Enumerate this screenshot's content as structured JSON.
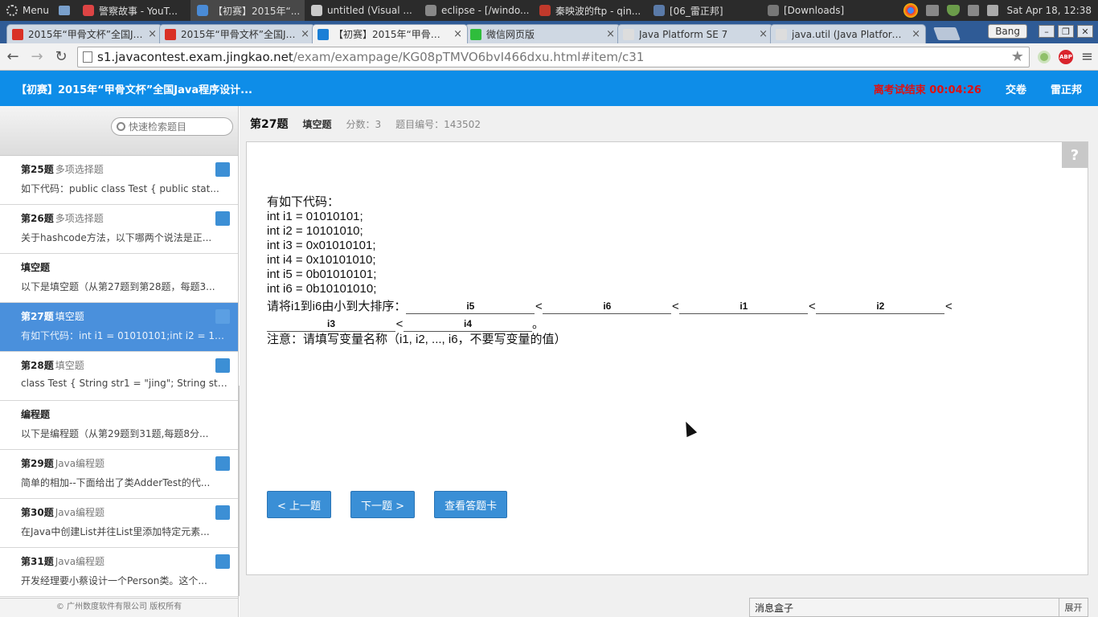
{
  "taskbar": {
    "menu_label": "Menu",
    "apps": [
      {
        "label": "警察故事 - YouT...",
        "color": "#d44"
      },
      {
        "label": "【初赛】2015年“...",
        "color": "#4a8bd6"
      },
      {
        "label": "untitled (Visual ...",
        "color": "#c9c9c9"
      },
      {
        "label": "eclipse - [/windo...",
        "color": "#888"
      },
      {
        "label": "秦映波的ftp - qin...",
        "color": "#c0392b"
      },
      {
        "label": "[06_雷正邦]",
        "color": "#5a7aa8"
      },
      {
        "label": "[Downloads]",
        "color": "#777"
      }
    ],
    "clock": "Sat Apr 18, 12:38"
  },
  "browser": {
    "tabs": [
      {
        "title": "2015年“甲骨文杯”全国Jav",
        "favicon_color": "#d93025",
        "active": false
      },
      {
        "title": "2015年“甲骨文杯”全国Jav",
        "favicon_color": "#d93025",
        "active": false
      },
      {
        "title": "【初赛】2015年“甲骨文杯",
        "favicon_color": "#1a7fd6",
        "active": true
      },
      {
        "title": "微信网页版",
        "favicon_color": "#2fbd3c",
        "active": false
      },
      {
        "title": "Java Platform SE 7",
        "favicon_color": "#dddddd",
        "active": false
      },
      {
        "title": "java.util (Java Platform SE",
        "favicon_color": "#dddddd",
        "active": false
      }
    ],
    "profile_label": "Bang",
    "url_host": "s1.javacontest.exam.jingkao.net",
    "url_path": "/exam/exampage/KG08pTMVO6bvI466dxu.html#item/c31",
    "abp_label": "ABP"
  },
  "app": {
    "title": "【初赛】2015年“甲骨文杯”全国Java程序设计...",
    "countdown": "离考试结束 00:04:26",
    "submit_label": "交卷",
    "user_name": "雷正邦",
    "brand_color": "#0e8de8"
  },
  "sidebar": {
    "search_placeholder": "快速检索题目",
    "items": [
      {
        "num": "第25题",
        "type": "多项选择题",
        "snippet": "如下代码：public class Test {     public stat...",
        "mark": true,
        "selected": false
      },
      {
        "num": "第26题",
        "type": "多项选择题",
        "snippet": "关于hashcode方法，以下哪两个说法是正...",
        "mark": true,
        "selected": false
      },
      {
        "num": "填空题",
        "type": "",
        "snippet": "以下是填空题（从第27题到第28题，每题3...",
        "mark": false,
        "selected": false
      },
      {
        "num": "第27题",
        "type": "填空题",
        "snippet": "有如下代码：int i1 = 01010101;int i2 = 101...",
        "mark": true,
        "selected": true
      },
      {
        "num": "第28题",
        "type": "填空题",
        "snippet": "class Test {  String str1 = \"jing\";  String str...",
        "mark": true,
        "selected": false
      },
      {
        "num": "编程题",
        "type": "",
        "snippet": "以下是编程题（从第29题到31题,每题8分...",
        "mark": false,
        "selected": false
      },
      {
        "num": "第29题",
        "type": "Java编程题",
        "snippet": "简单的相加--下面给出了类AdderTest的代...",
        "mark": true,
        "selected": false
      },
      {
        "num": "第30题",
        "type": "Java编程题",
        "snippet": "在Java中创建List并往List里添加特定元素...",
        "mark": true,
        "selected": false
      },
      {
        "num": "第31题",
        "type": "Java编程题",
        "snippet": "开发经理要小蔡设计一个Person类。这个...",
        "mark": true,
        "selected": false
      }
    ],
    "footer": "© 广州数度软件有限公司 版权所有"
  },
  "question": {
    "title": "第27题",
    "kind": "填空题",
    "score": "分数：3",
    "id_text": "题目编号：143502",
    "help": "?",
    "lines": [
      "有如下代码：",
      "int i1 = 01010101;",
      "int i2 = 10101010;",
      "int i3 = 0x01010101;",
      "int i4 = 0x10101010;",
      "int i5 = 0b01010101;",
      "int i6 = 0b10101010;"
    ],
    "prompt": "请将i1到i6由小到大排序：",
    "answers": [
      "i5",
      "i6",
      "i1",
      "i2",
      "i3",
      "i4"
    ],
    "lt": "<",
    "end_mark": "。",
    "note": "注意：请填写变量名称（i1, i2, ..., i6，不要写变量的值）",
    "prev_label": "< 上一题",
    "next_label": "下一题 >",
    "card_label": "查看答题卡"
  },
  "msgbox": {
    "label": "消息盒子",
    "expand": "展开"
  }
}
